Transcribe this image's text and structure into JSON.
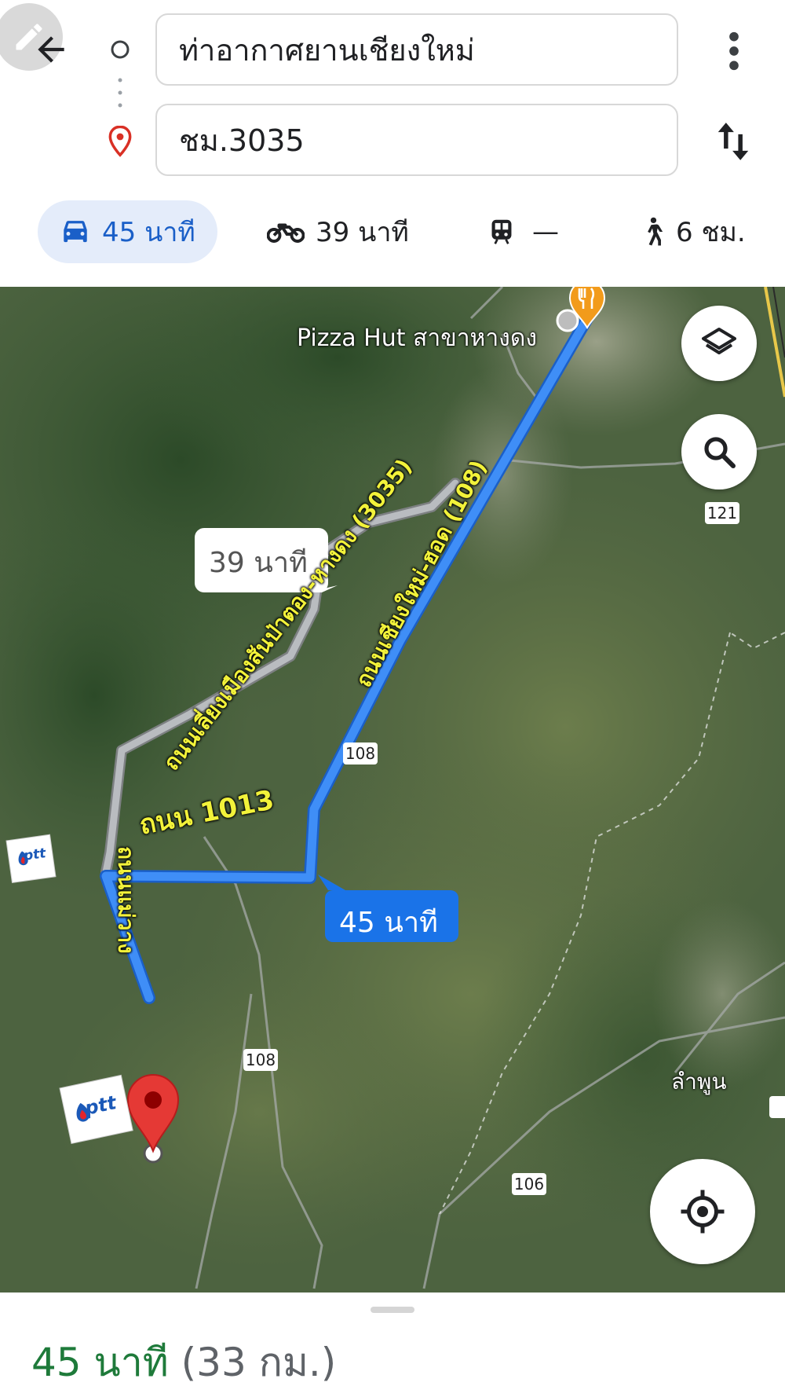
{
  "search": {
    "origin_value": "ท่าอากาศยานเชียงใหม่",
    "destination_value": "ชม.3035"
  },
  "modes": [
    {
      "icon": "car-icon",
      "label": "45 นาที",
      "active": true
    },
    {
      "icon": "motorcycle-icon",
      "label": "39 นาที",
      "active": false
    },
    {
      "icon": "transit-icon",
      "label": "—",
      "active": false
    },
    {
      "icon": "walking-icon",
      "label": "6 ชม.",
      "active": false
    }
  ],
  "map": {
    "poi_label": "Pizza Hut สาขาหางดง",
    "alt_route_time": "39 นาที",
    "main_route_time": "45 นาที",
    "road_labels": {
      "road_3035": "ถนนเลี่ยงเมืองสันป่าตอง-หางดง (3035)",
      "road_108": "ถนนเชียงใหม่-ฮอด (108)",
      "road_1013": "ถนน 1013",
      "road_left": "ถนนแม่วาง"
    },
    "shields": [
      "121",
      "108",
      "108",
      "106"
    ],
    "town_label": "ลำพูน",
    "ptt_labels": [
      "ptt",
      "ptt"
    ],
    "colors": {
      "route": "#3f8ef7",
      "alt_route": "#b9bcc0",
      "pin": "#e53935",
      "poi": "#f29b1b",
      "annotation": "#f2f23a"
    }
  },
  "summary": {
    "duration": "45 นาที",
    "distance": "(33 กม.)"
  }
}
